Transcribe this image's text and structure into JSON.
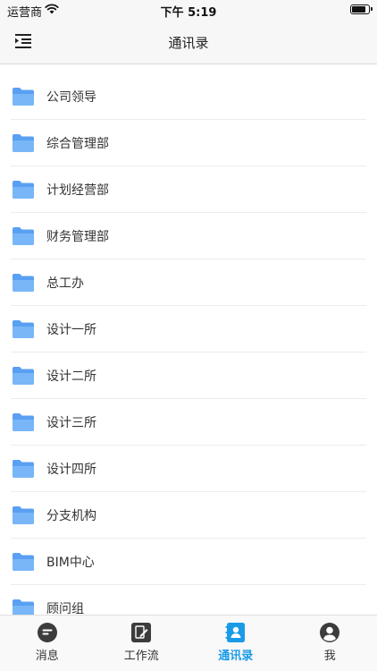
{
  "status_bar": {
    "carrier": "运营商",
    "time": "下午 5:19",
    "battery_level": 0.9
  },
  "header": {
    "title": "通讯录",
    "menu_icon": "indent-menu-icon"
  },
  "colors": {
    "folder": "#5aa0f2",
    "accent": "#1a9be8",
    "tab_icon": "#3c3c3c"
  },
  "departments": [
    {
      "label": "公司领导",
      "icon": "folder-icon"
    },
    {
      "label": "综合管理部",
      "icon": "folder-icon"
    },
    {
      "label": "计划经营部",
      "icon": "folder-icon"
    },
    {
      "label": "财务管理部",
      "icon": "folder-icon"
    },
    {
      "label": "总工办",
      "icon": "folder-icon"
    },
    {
      "label": "设计一所",
      "icon": "folder-icon"
    },
    {
      "label": "设计二所",
      "icon": "folder-icon"
    },
    {
      "label": "设计三所",
      "icon": "folder-icon"
    },
    {
      "label": "设计四所",
      "icon": "folder-icon"
    },
    {
      "label": "分支机构",
      "icon": "folder-icon"
    },
    {
      "label": "BIM中心",
      "icon": "folder-icon"
    },
    {
      "label": "顾问组",
      "icon": "folder-icon"
    }
  ],
  "tabs": [
    {
      "label": "消息",
      "icon": "message-icon",
      "active": false
    },
    {
      "label": "工作流",
      "icon": "workflow-icon",
      "active": false
    },
    {
      "label": "通讯录",
      "icon": "contacts-icon",
      "active": true
    },
    {
      "label": "我",
      "icon": "profile-icon",
      "active": false
    }
  ]
}
